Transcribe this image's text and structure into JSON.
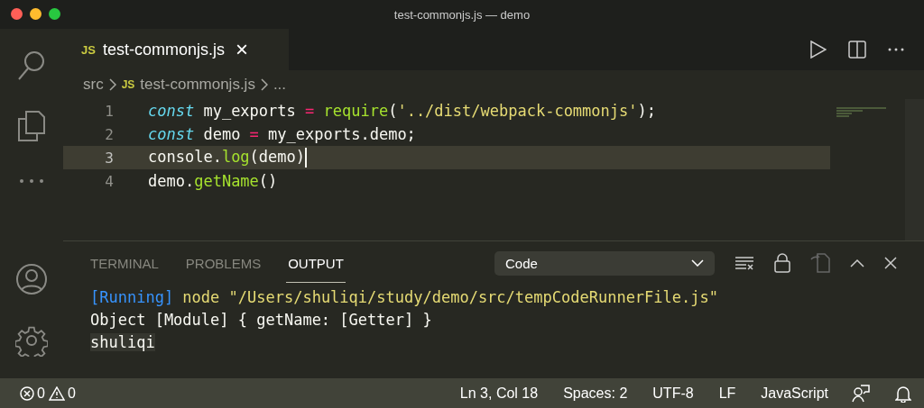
{
  "window": {
    "title": "test-commonjs.js — demo"
  },
  "editor_tab": {
    "badge": "JS",
    "label": "test-commonjs.js",
    "close": "×"
  },
  "breadcrumbs": {
    "folder": "src",
    "badge": "JS",
    "file": "test-commonjs.js",
    "more": "..."
  },
  "code_lines": [
    {
      "number": "1",
      "current": false,
      "tokens": [
        {
          "kind": "keyword",
          "text": "const"
        },
        {
          "kind": "plain",
          "text": " my_exports "
        },
        {
          "kind": "operator",
          "text": "="
        },
        {
          "kind": "function",
          "text": " require"
        },
        {
          "kind": "plain",
          "text": "("
        },
        {
          "kind": "string",
          "text": "'../dist/webpack-commonjs'"
        },
        {
          "kind": "plain",
          "text": ");"
        }
      ]
    },
    {
      "number": "2",
      "current": false,
      "tokens": [
        {
          "kind": "keyword",
          "text": "const"
        },
        {
          "kind": "plain",
          "text": " demo "
        },
        {
          "kind": "operator",
          "text": "="
        },
        {
          "kind": "plain",
          "text": " my_exports.demo;"
        }
      ]
    },
    {
      "number": "3",
      "current": true,
      "tokens": [
        {
          "kind": "plain",
          "text": "console."
        },
        {
          "kind": "function",
          "text": "log"
        },
        {
          "kind": "plain",
          "text": "(demo)"
        }
      ]
    },
    {
      "number": "4",
      "current": false,
      "tokens": [
        {
          "kind": "plain",
          "text": "demo."
        },
        {
          "kind": "function",
          "text": "getName"
        },
        {
          "kind": "plain",
          "text": "()"
        }
      ]
    }
  ],
  "panel": {
    "tabs": [
      {
        "label": "TERMINAL",
        "selected": false
      },
      {
        "label": "PROBLEMS",
        "selected": false
      },
      {
        "label": "OUTPUT",
        "selected": true
      }
    ],
    "channel": "Code",
    "output_lines": [
      [
        {
          "kind": "info",
          "text": "[Running]"
        },
        {
          "kind": "path",
          "text": " node \"/Users/shuliqi/study/demo/src/tempCodeRunnerFile.js\""
        }
      ],
      [
        {
          "kind": "plain",
          "text": "Object [Module] { getName: [Getter] }"
        }
      ],
      [
        {
          "kind": "match",
          "text": "shuliqi"
        }
      ]
    ]
  },
  "status_bar": {
    "errors": "0",
    "warnings": "0",
    "items": [
      "Ln 3, Col 18",
      "Spaces: 2",
      "UTF-8",
      "LF",
      "JavaScript"
    ]
  }
}
